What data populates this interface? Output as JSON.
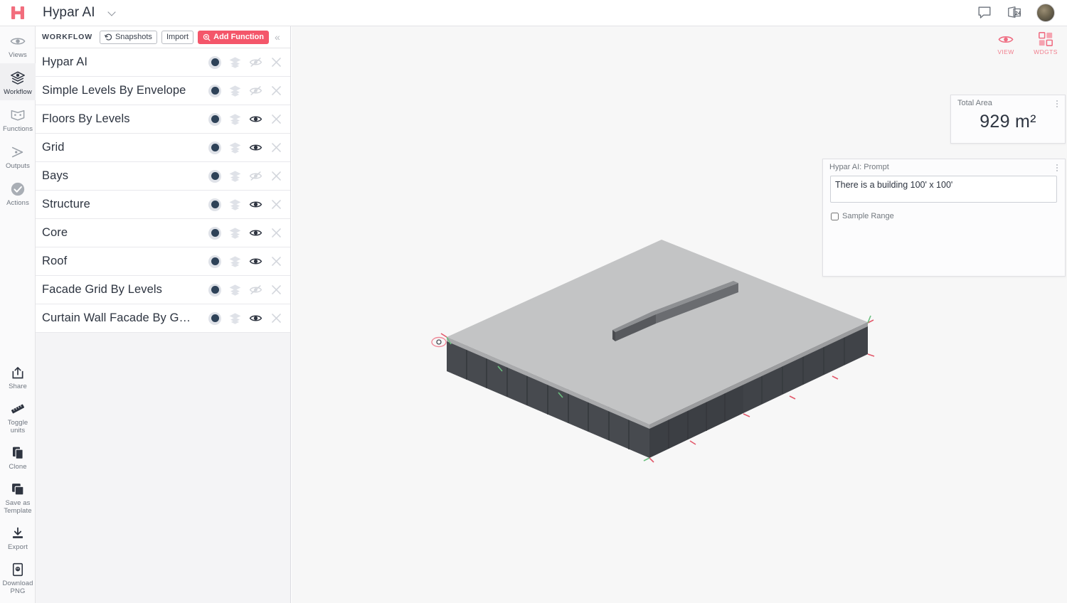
{
  "topbar": {
    "logo": "H",
    "logo_icon": "hypar-logo-icon",
    "project_title": "Hypar AI",
    "dropdown_icon": "chevron-down-icon",
    "comment_icon": "comment-bubble-icon",
    "notifications_icon": "calendar-24-icon",
    "avatar_icon": "user-avatar"
  },
  "rail": {
    "top_items": [
      {
        "label": "Views",
        "icon": "eye-icon",
        "active": false
      },
      {
        "label": "Workflow",
        "icon": "layers-check-icon",
        "active": true
      },
      {
        "label": "Functions",
        "icon": "open-book-icon",
        "active": false
      },
      {
        "label": "Outputs",
        "icon": "arrow-node-icon",
        "active": false
      },
      {
        "label": "Actions",
        "icon": "check-circle-icon",
        "active": false
      }
    ],
    "bottom_items": [
      {
        "label": "Share",
        "icon": "share-icon"
      },
      {
        "label": "Toggle units",
        "icon": "ruler-icon"
      },
      {
        "label": "Clone",
        "icon": "copy-icon"
      },
      {
        "label": "Save as Template",
        "icon": "save-template-icon"
      },
      {
        "label": "Export",
        "icon": "download-arrow-icon"
      },
      {
        "label": "Download PNG",
        "icon": "file-image-icon"
      }
    ]
  },
  "panel": {
    "title": "WORKFLOW",
    "snapshots_label": "Snapshots",
    "snapshots_icon": "history-icon",
    "import_label": "Import",
    "add_function_label": "Add Function",
    "add_function_icon": "plus-circle-icon",
    "collapse_icon": "chevron-double-left-icon",
    "collapse_glyph": "«",
    "accent_color": "#f4566a",
    "rows": [
      {
        "name": "Hypar AI",
        "visible": false
      },
      {
        "name": "Simple Levels By Envelope",
        "visible": false
      },
      {
        "name": "Floors By Levels",
        "visible": true
      },
      {
        "name": "Grid",
        "visible": true
      },
      {
        "name": "Bays",
        "visible": false
      },
      {
        "name": "Structure",
        "visible": true
      },
      {
        "name": "Core",
        "visible": true
      },
      {
        "name": "Roof",
        "visible": true
      },
      {
        "name": "Facade Grid By Levels",
        "visible": false
      },
      {
        "name": "Curtain Wall Facade By G…",
        "visible": true
      }
    ]
  },
  "viewport": {
    "tools": [
      {
        "label": "VIEW",
        "icon": "eye-icon"
      },
      {
        "label": "WDGTS",
        "icon": "widgets-grid-icon"
      }
    ],
    "model_description": "3d-building-model",
    "background_color": "#f7f7f7"
  },
  "widgets": {
    "total_area": {
      "title": "Total Area",
      "value": "929 m²",
      "menu_icon": "kebab-menu-icon"
    },
    "prompt": {
      "title": "Hypar AI: Prompt",
      "value": "There is a building 100' x 100'",
      "placeholder": "",
      "checkbox_label": "Sample Range",
      "checkbox_checked": false,
      "menu_icon": "kebab-menu-icon"
    }
  }
}
